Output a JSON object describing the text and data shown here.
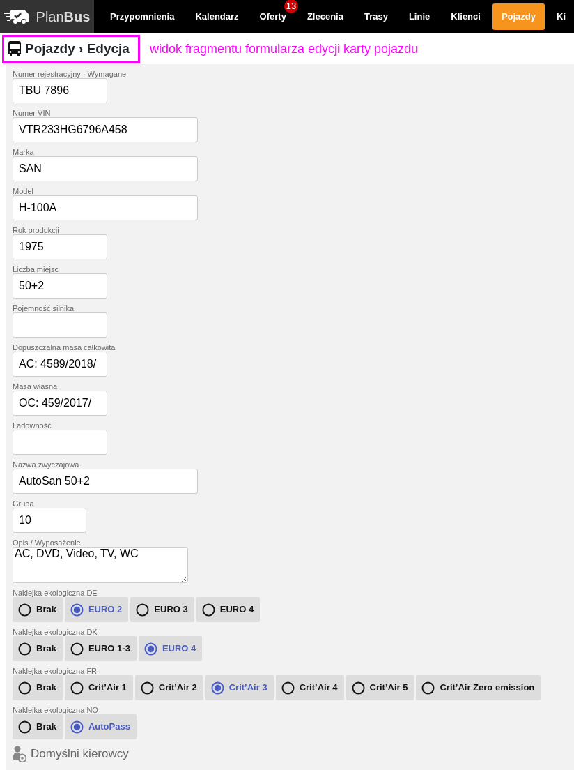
{
  "brand": {
    "text_light": "Plan",
    "text_bold": "Bus"
  },
  "nav": [
    {
      "label": "Przypomnienia",
      "selected": false
    },
    {
      "label": "Kalendarz",
      "selected": false
    },
    {
      "label": "Oferty",
      "selected": false,
      "badge": "13"
    },
    {
      "label": "Zlecenia",
      "selected": false
    },
    {
      "label": "Trasy",
      "selected": false
    },
    {
      "label": "Linie",
      "selected": false
    },
    {
      "label": "Klienci",
      "selected": false
    },
    {
      "label": "Pojazdy",
      "selected": true
    },
    {
      "label": "Ki",
      "selected": false
    }
  ],
  "breadcrumb": "Pojazdy › Edycja",
  "annotation": "widok fragmentu formularza edycji karty pojazdu",
  "fields": [
    {
      "label": "Numer rejestracyjny · Wymagane",
      "value": "TBU 7896",
      "kind": "short"
    },
    {
      "label": "Numer VIN",
      "value": "VTR233HG6796A458",
      "kind": "long"
    },
    {
      "label": "Marka",
      "value": "SAN",
      "kind": "long"
    },
    {
      "label": "Model",
      "value": "H-100A",
      "kind": "long"
    },
    {
      "label": "Rok produkcji",
      "value": "1975",
      "kind": "short"
    },
    {
      "label": "Liczba miejsc",
      "value": "50+2",
      "kind": "short"
    },
    {
      "label": "Pojemność silnika",
      "kind": "short"
    },
    {
      "label": "Dopuszczalna masa całkowita",
      "value": "AC: 4589/2018/",
      "kind": "short"
    },
    {
      "label": "Masa własna",
      "value": "OC: 459/2017/",
      "kind": "short"
    },
    {
      "label": "Ładowność",
      "kind": "short"
    },
    {
      "label": "Nazwa zwyczajowa",
      "value": "AutoSan 50+2",
      "kind": "long"
    },
    {
      "label": "Grupa",
      "value": "10",
      "kind": "narrow"
    },
    {
      "label": "Opis / Wyposażenie",
      "value": "AC, DVD, Video, TV, WC",
      "kind": "textarea"
    }
  ],
  "radio_groups": [
    {
      "label": "Naklejka ekologiczna DE",
      "options": [
        {
          "label": "Brak",
          "selected": false
        },
        {
          "label": "EURO 2",
          "selected": true
        },
        {
          "label": "EURO 3",
          "selected": false
        },
        {
          "label": "EURO 4",
          "selected": false
        }
      ]
    },
    {
      "label": "Naklejka ekologiczna DK",
      "options": [
        {
          "label": "Brak",
          "selected": false
        },
        {
          "label": "EURO 1-3",
          "selected": false
        },
        {
          "label": "EURO 4",
          "selected": true
        }
      ]
    },
    {
      "label": "Naklejka ekologiczna FR",
      "options": [
        {
          "label": "Brak",
          "selected": false
        },
        {
          "label": "Crit’Air 1",
          "selected": false
        },
        {
          "label": "Crit’Air 2",
          "selected": false
        },
        {
          "label": "Crit’Air 3",
          "selected": true
        },
        {
          "label": "Crit’Air 4",
          "selected": false
        },
        {
          "label": "Crit’Air 5",
          "selected": false
        },
        {
          "label": "Crit’Air Zero emission",
          "selected": false
        }
      ]
    },
    {
      "label": "Naklejka ekologiczna NO",
      "options": [
        {
          "label": "Brak",
          "selected": false
        },
        {
          "label": "AutoPass",
          "selected": true
        }
      ]
    }
  ],
  "section_title": "Domyślni kierowcy"
}
